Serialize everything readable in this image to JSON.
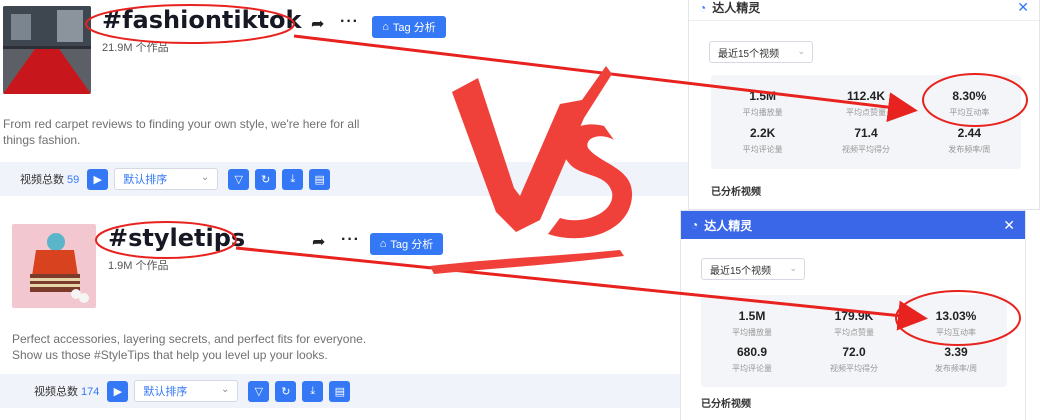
{
  "top": {
    "tag": "#fashiontiktok",
    "works": "21.9M 个作品",
    "tag_button": "Tag 分析",
    "description": [
      "From red carpet reviews to finding your own style, we're here for all",
      "things fashion."
    ],
    "video_count_label": "视频总数",
    "video_count": "59",
    "sort_label": "默认排序"
  },
  "bottom": {
    "tag": "#styletips",
    "works": "1.9M 个作品",
    "tag_button": "Tag 分析",
    "description": [
      "Perfect accessories, layering secrets, and perfect fits for everyone.",
      "Show us those #StyleTips that help you level up your looks."
    ],
    "video_count_label": "视频总数",
    "video_count": "174",
    "sort_label": "默认排序"
  },
  "panel_top": {
    "title": "达人精灵",
    "range": "最近15个视频",
    "stats": [
      {
        "value": "1.5M",
        "label": "平均播放量"
      },
      {
        "value": "112.4K",
        "label": "平均点赞量"
      },
      {
        "value": "8.30%",
        "label": "平均互动率"
      },
      {
        "value": "2.2K",
        "label": "平均评论量"
      },
      {
        "value": "71.4",
        "label": "视频平均得分"
      },
      {
        "value": "2.44",
        "label": "发布频率/周"
      }
    ],
    "analyzed": "已分析视频"
  },
  "panel_bottom": {
    "title": "达人精灵",
    "range": "最近15个视频",
    "stats": [
      {
        "value": "1.5M",
        "label": "平均播放量"
      },
      {
        "value": "179.9K",
        "label": "平均点赞量"
      },
      {
        "value": "13.03%",
        "label": "平均互动率"
      },
      {
        "value": "680.9",
        "label": "平均评论量"
      },
      {
        "value": "72.0",
        "label": "视频平均得分"
      },
      {
        "value": "3.39",
        "label": "发布频率/周"
      }
    ],
    "analyzed": "已分析视频"
  },
  "vs_text": "VS",
  "colors": {
    "accent": "#3478f6",
    "annotation_red": "#e8231f",
    "panel_head_bottom": "#3a67e8"
  }
}
